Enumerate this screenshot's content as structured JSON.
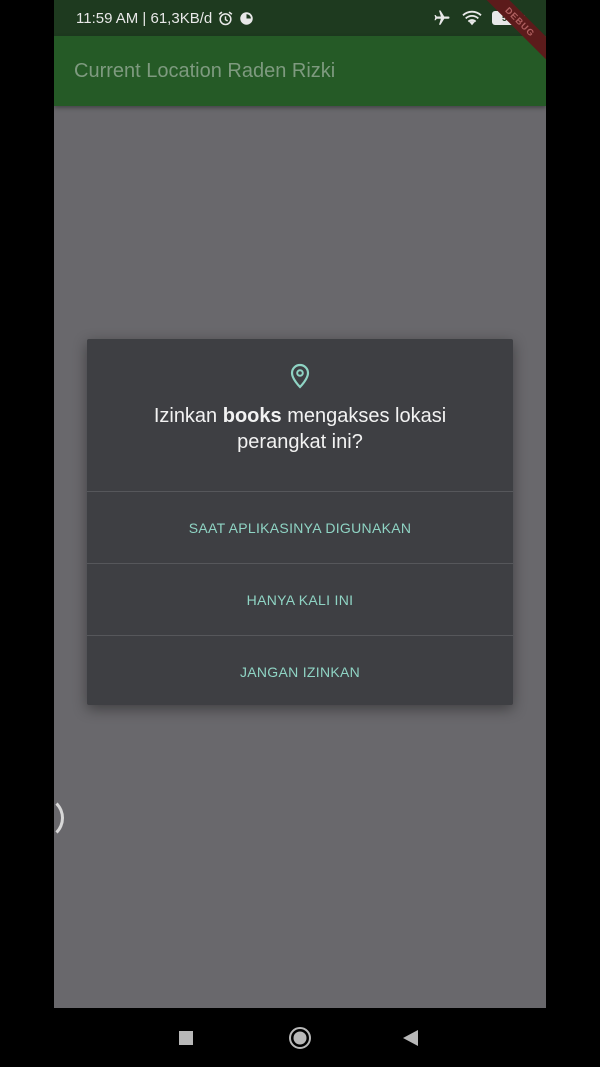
{
  "status_bar": {
    "time_speed": "11:59 AM | 61,3KB/d",
    "battery": "56",
    "icons": [
      "alarm-icon",
      "data-saver-icon",
      "airplane-mode-icon",
      "wifi-icon",
      "battery-icon"
    ]
  },
  "app_bar": {
    "title": "Current Location Raden Rizki",
    "color": "#255a26"
  },
  "debug_ribbon": "DEBUG",
  "dialog": {
    "icon": "location-pin-icon",
    "title_prefix": "Izinkan ",
    "title_app": "books",
    "title_suffix": " mengakses lokasi perangkat ini?",
    "options": [
      "SAAT APLIKASINYA DIGUNAKAN",
      "HANYA KALI INI",
      "JANGAN IZINKAN"
    ],
    "accent": "#8fd4c4"
  },
  "nav_bar": {
    "icons": [
      "recents-square-icon",
      "home-circle-icon",
      "back-triangle-icon"
    ]
  }
}
